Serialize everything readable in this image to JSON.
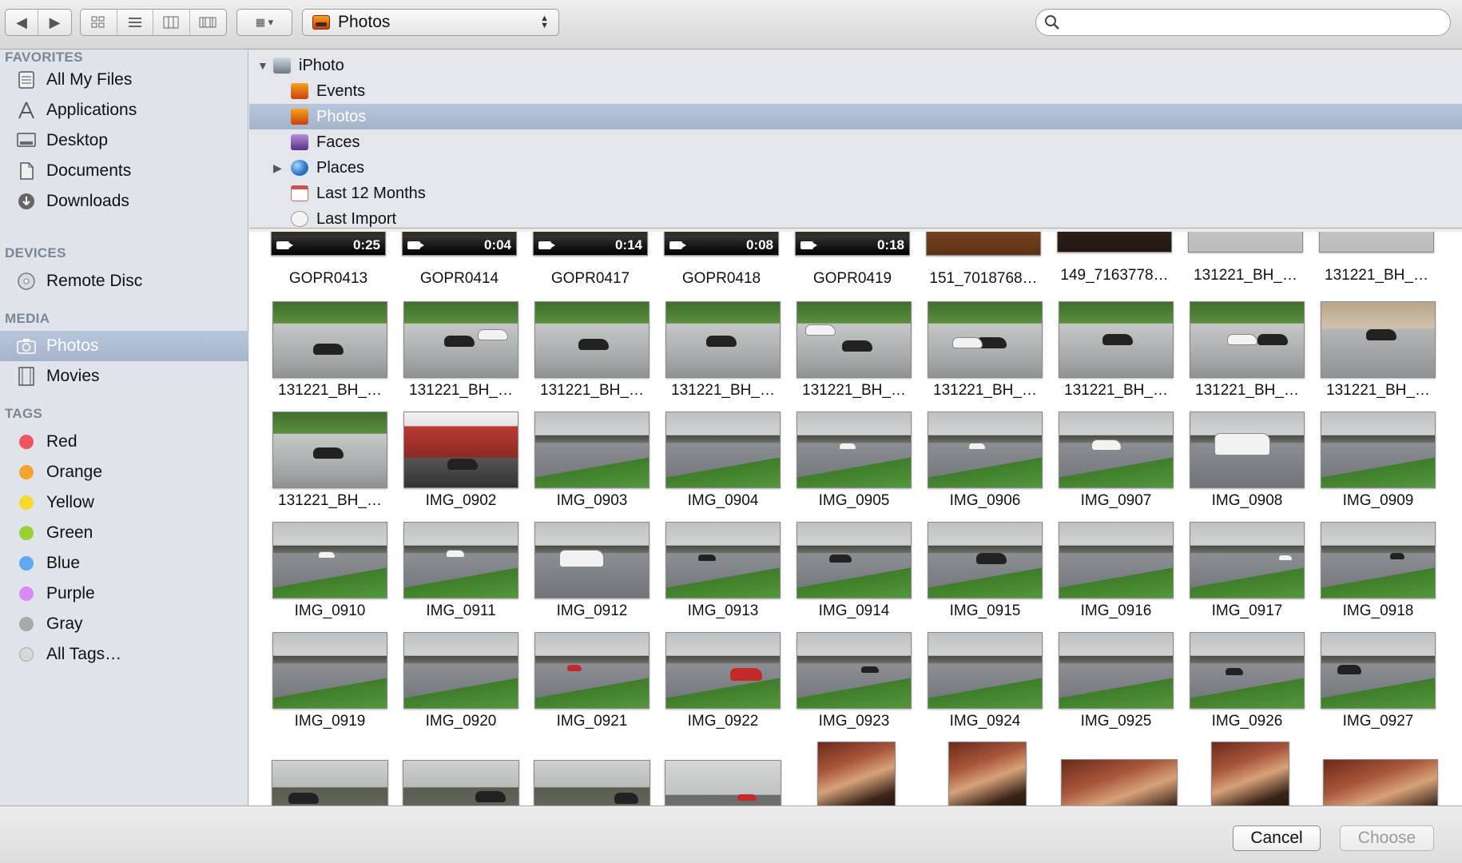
{
  "toolbar": {
    "source_label": "Photos",
    "search_placeholder": ""
  },
  "sidebar": {
    "favorites_header": "FAVORITES",
    "favorites": [
      {
        "label": "All My Files",
        "icon": "all-my-files-icon"
      },
      {
        "label": "Applications",
        "icon": "applications-icon"
      },
      {
        "label": "Desktop",
        "icon": "desktop-icon"
      },
      {
        "label": "Documents",
        "icon": "documents-icon"
      },
      {
        "label": "Downloads",
        "icon": "downloads-icon"
      }
    ],
    "devices_header": "DEVICES",
    "devices": [
      {
        "label": "Remote Disc",
        "icon": "remote-disc-icon"
      }
    ],
    "media_header": "MEDIA",
    "media": [
      {
        "label": "Photos",
        "icon": "camera-icon",
        "selected": true
      },
      {
        "label": "Movies",
        "icon": "film-icon"
      }
    ],
    "tags_header": "TAGS",
    "tags": [
      {
        "label": "Red",
        "color": "#f2545b"
      },
      {
        "label": "Orange",
        "color": "#f7a42c"
      },
      {
        "label": "Yellow",
        "color": "#f6d92f"
      },
      {
        "label": "Green",
        "color": "#97d234"
      },
      {
        "label": "Blue",
        "color": "#5fa8f0"
      },
      {
        "label": "Purple",
        "color": "#d88af0"
      },
      {
        "label": "Gray",
        "color": "#a8a8a8"
      },
      {
        "label": "All Tags…",
        "color": "#d8d8d8"
      }
    ]
  },
  "tree": {
    "root": "iPhoto",
    "items": [
      "Events",
      "Photos",
      "Faces",
      "Places",
      "Last 12 Months",
      "Last Import"
    ]
  },
  "grid": {
    "row0": [
      {
        "name": "GOPR0413",
        "duration": "0:25"
      },
      {
        "name": "GOPR0414",
        "duration": "0:04"
      },
      {
        "name": "GOPR0417",
        "duration": "0:14"
      },
      {
        "name": "GOPR0418",
        "duration": "0:08"
      },
      {
        "name": "GOPR0419",
        "duration": "0:18"
      },
      {
        "name": "151_7018768…"
      },
      {
        "name": "149_7163778…"
      },
      {
        "name": "131221_BH_…"
      },
      {
        "name": "131221_BH_…"
      }
    ],
    "rows": [
      [
        "131221_BH_…",
        "131221_BH_…",
        "131221_BH_…",
        "131221_BH_…",
        "131221_BH_…",
        "131221_BH_…",
        "131221_BH_…",
        "131221_BH_…",
        "131221_BH_…"
      ],
      [
        "131221_BH_…",
        "IMG_0902",
        "IMG_0903",
        "IMG_0904",
        "IMG_0905",
        "IMG_0906",
        "IMG_0907",
        "IMG_0908",
        "IMG_0909"
      ],
      [
        "IMG_0910",
        "IMG_0911",
        "IMG_0912",
        "IMG_0913",
        "IMG_0914",
        "IMG_0915",
        "IMG_0916",
        "IMG_0917",
        "IMG_0918"
      ],
      [
        "IMG_0919",
        "IMG_0920",
        "IMG_0921",
        "IMG_0922",
        "IMG_0923",
        "IMG_0924",
        "IMG_0925",
        "IMG_0926",
        "IMG_0927"
      ]
    ]
  },
  "footer": {
    "cancel_label": "Cancel",
    "choose_label": "Choose"
  }
}
